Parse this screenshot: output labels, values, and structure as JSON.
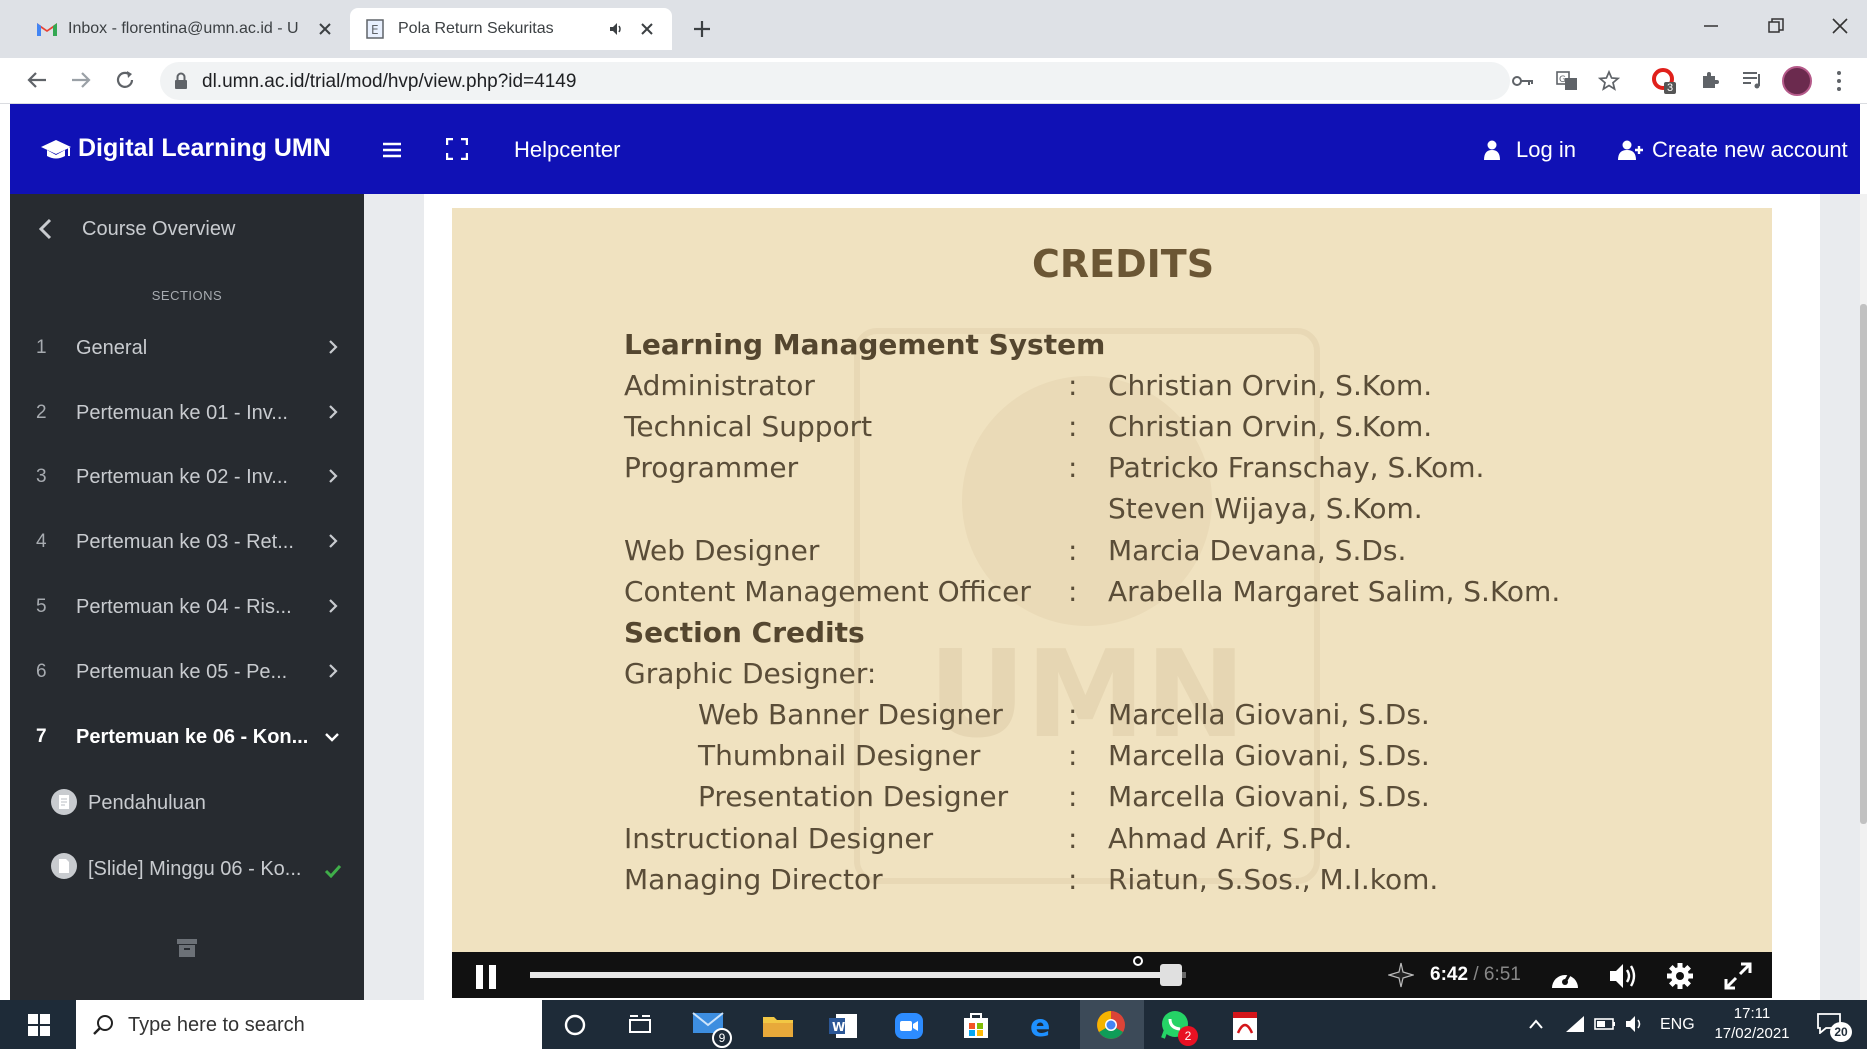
{
  "browser": {
    "tabs": [
      {
        "title": "Inbox - florentina@umn.ac.id - U",
        "active": false
      },
      {
        "title": "Pola Return Sekuritas",
        "active": true
      }
    ],
    "url": "dl.umn.ac.id/trial/mod/hvp/view.php?id=4149",
    "extension_badge": "3"
  },
  "header": {
    "brand": "Digital Learning UMN",
    "helpcenter": "Helpcenter",
    "login": "Log in",
    "create_account": "Create new account"
  },
  "sidebar": {
    "course_overview": "Course Overview",
    "sections_heading": "SECTIONS",
    "items": [
      {
        "num": "1",
        "label": "General"
      },
      {
        "num": "2",
        "label": "Pertemuan ke 01 - Inv..."
      },
      {
        "num": "3",
        "label": "Pertemuan ke 02 - Inv..."
      },
      {
        "num": "4",
        "label": "Pertemuan ke 03 - Ret..."
      },
      {
        "num": "5",
        "label": "Pertemuan ke 04 - Ris..."
      },
      {
        "num": "6",
        "label": "Pertemuan ke 05 - Pe..."
      },
      {
        "num": "7",
        "label": "Pertemuan ke 06 - Kon..."
      }
    ],
    "sub_items": [
      {
        "label": "Pendahuluan",
        "completed": false
      },
      {
        "label": "[Slide] Minggu 06 - Ko...",
        "completed": true
      }
    ]
  },
  "credits": {
    "title": "CREDITS",
    "lms_heading": "Learning Management System",
    "lms_rows": [
      {
        "role": "Administrator",
        "names": [
          "Christian Orvin, S.Kom."
        ]
      },
      {
        "role": "Technical Support",
        "names": [
          "Christian Orvin, S.Kom."
        ]
      },
      {
        "role": "Programmer",
        "names": [
          "Patricko Franschay, S.Kom.",
          "Steven Wijaya, S.Kom."
        ]
      },
      {
        "role": "Web Designer",
        "names": [
          "Marcia Devana, S.Ds."
        ]
      },
      {
        "role": "Content Management Officer",
        "names": [
          "Arabella Margaret Salim, S.Kom."
        ]
      }
    ],
    "section_heading": "Section Credits",
    "graphic_heading": "Graphic Designer:",
    "graphic_rows": [
      {
        "role": "Web Banner Designer",
        "name": "Marcella Giovani, S.Ds."
      },
      {
        "role": "Thumbnail Designer",
        "name": "Marcella Giovani, S.Ds."
      },
      {
        "role": "Presentation Designer",
        "name": "Marcella Giovani, S.Ds."
      }
    ],
    "other_rows": [
      {
        "role": "Instructional Designer",
        "name": "Ahmad Arif, S.Pd."
      },
      {
        "role": "Managing Director",
        "name": "Riatun, S.Sos., M.I.kom."
      }
    ],
    "colon": ":"
  },
  "player": {
    "current_time": "6:42",
    "separator": "/",
    "duration": "6:51",
    "progress": 0.977
  },
  "taskbar": {
    "search_placeholder": "Type here to search",
    "mail_badge": "9",
    "whatsapp_badge": "2",
    "language": "ENG",
    "time": "17:11",
    "date": "17/02/2021",
    "notifications": "20"
  },
  "colors": {
    "header_bg": "#1011b5",
    "sidebar_bg": "#272b30",
    "video_bg": "#f0e2c0",
    "check_green": "#3fae49"
  }
}
